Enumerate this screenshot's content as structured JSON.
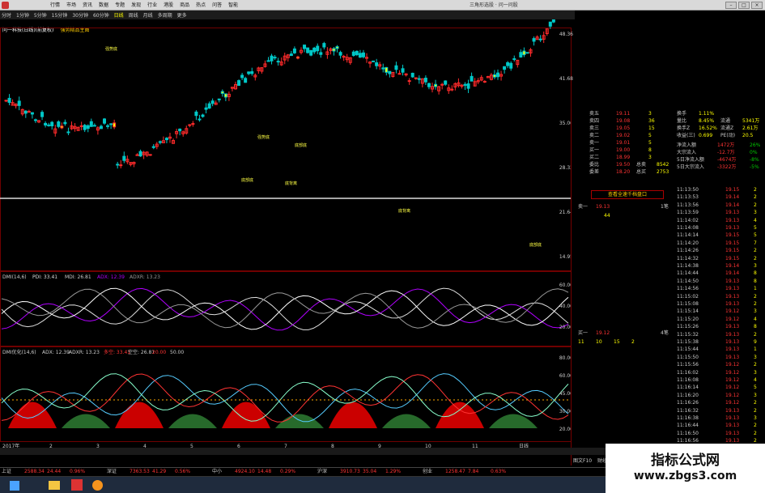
{
  "menubar": {
    "items": [
      "行情",
      "市场",
      "资讯",
      "数据",
      "专题",
      "发现",
      "行业",
      "港股",
      "商品",
      "热点",
      "问答",
      "智能"
    ],
    "title": "三角形选股 · 问一问股"
  },
  "toolbar": {
    "timeframes": [
      "分时",
      "1分钟",
      "5分钟",
      "15分钟",
      "30分钟",
      "60分钟",
      "日线",
      "周线",
      "月线",
      "多周期",
      "更多"
    ],
    "active": 6
  },
  "chart_header": {
    "left": "问一科技(日线)(前复权)",
    "right": "强势精品主图"
  },
  "main_chart": {
    "price_labels": [
      "48.36",
      "41.68",
      "35.00",
      "28.32",
      "21.64",
      "14.95"
    ],
    "tags": [
      "强势底",
      "强势底",
      "底部底",
      "底部底",
      "底背离",
      "底背离",
      "底部底"
    ]
  },
  "dmi": {
    "title": "DMI(14,6)",
    "pdi": "PDI: 33.41",
    "mdi": "MDI: 26.81",
    "adx": "ADX: 12.39",
    "adxr": "ADXR: 13.23",
    "axis": [
      "60.00",
      "40.00",
      "20.00"
    ]
  },
  "dmi2": {
    "title": "DMI优化(14,6)",
    "adx": "ADX: 12.39",
    "adxr": "ADXR: 13.23",
    "pdi": "多空: 33.41",
    "mdi": "空空: 26.81",
    "up": "20.00",
    "down": "50.00",
    "axis": [
      "80.00",
      "60.00",
      "45.00",
      "30.00",
      "20.00"
    ]
  },
  "time_axis": [
    "2017年",
    "2",
    "3",
    "4",
    "5",
    "6",
    "7",
    "8",
    "9",
    "10",
    "11",
    "日线"
  ],
  "side": {
    "sell_rows": [
      [
        "卖五",
        "19.11",
        "3"
      ],
      [
        "卖四",
        "19.08",
        "36"
      ],
      [
        "卖三",
        "19.05",
        "15"
      ],
      [
        "卖二",
        "19.02",
        "5"
      ],
      [
        "卖一",
        "19.01",
        "5"
      ]
    ],
    "buy_rows": [
      [
        "买一",
        "19.00",
        "8"
      ],
      [
        "买二",
        "18.99",
        "3"
      ]
    ],
    "totals": [
      [
        "委比",
        "19.50",
        "总卖",
        "8542"
      ],
      [
        "委差",
        "18.20",
        "总买",
        "2753"
      ]
    ],
    "info_rows": [
      [
        "换手",
        "1.11%"
      ],
      [
        "量比",
        "8.45%",
        "流通",
        "5341万"
      ],
      [
        "换手Z",
        "16.52%",
        "流通Z",
        "2.61万"
      ],
      [
        "收益(三)",
        "0.699",
        "PE(动)",
        "20.5"
      ]
    ],
    "flow_rows": [
      [
        "净流入额",
        "1472万",
        "26%"
      ],
      [
        "大宗流入",
        "-12.7万",
        "0%"
      ],
      [
        "5日净流入额",
        "-4674万",
        "-8%"
      ],
      [
        "5日大宗流入",
        "-3322万",
        "-5%"
      ]
    ],
    "button": "查看全速千档盘口",
    "sell_queue": [
      "卖一",
      "19.13",
      "1笔"
    ],
    "bid_queue": [
      "买一",
      "19.12",
      "4笔"
    ],
    "queue_vals": [
      "11",
      "10",
      "15",
      "2"
    ],
    "qty_label": "44",
    "ticks": [
      [
        "11:13:50",
        "19.15",
        "2"
      ],
      [
        "11:13:53",
        "19.14",
        "2"
      ],
      [
        "11:13:56",
        "19.14",
        "2"
      ],
      [
        "11:13:59",
        "19.13",
        "3"
      ],
      [
        "11:14:02",
        "19.13",
        "4"
      ],
      [
        "11:14:08",
        "19.13",
        "5"
      ],
      [
        "11:14:14",
        "19.15",
        "5"
      ],
      [
        "11:14:20",
        "19.15",
        "7"
      ],
      [
        "11:14:26",
        "19.15",
        "2"
      ],
      [
        "11:14:32",
        "19.15",
        "2"
      ],
      [
        "11:14:38",
        "19.14",
        "3"
      ],
      [
        "11:14:44",
        "19.14",
        "8"
      ],
      [
        "11:14:50",
        "19.13",
        "8"
      ],
      [
        "11:14:56",
        "19.13",
        "1"
      ],
      [
        "11:15:02",
        "19.13",
        "2"
      ],
      [
        "11:15:08",
        "19.13",
        "2"
      ],
      [
        "11:15:14",
        "19.12",
        "3"
      ],
      [
        "11:15:20",
        "19.12",
        "4"
      ],
      [
        "11:15:26",
        "19.13",
        "8"
      ],
      [
        "11:15:32",
        "19.13",
        "2"
      ],
      [
        "11:15:38",
        "19.13",
        "9"
      ],
      [
        "11:15:44",
        "19.13",
        "1"
      ],
      [
        "11:15:50",
        "19.13",
        "3"
      ],
      [
        "11:15:56",
        "19.12",
        "2"
      ],
      [
        "11:16:02",
        "19.12",
        "3"
      ],
      [
        "11:16:08",
        "19.12",
        "4"
      ],
      [
        "11:16:14",
        "19.12",
        "5"
      ],
      [
        "11:16:20",
        "19.12",
        "3"
      ],
      [
        "11:16:26",
        "19.12",
        "2"
      ],
      [
        "11:16:32",
        "19.13",
        "2"
      ],
      [
        "11:16:38",
        "19.13",
        "3"
      ],
      [
        "11:16:44",
        "19.13",
        "2"
      ],
      [
        "11:16:50",
        "19.13",
        "2"
      ],
      [
        "11:16:56",
        "19.13",
        "2"
      ],
      [
        "11:17:02",
        "19.15",
        "7"
      ],
      [
        "11:17:08",
        "19.15",
        "1"
      ]
    ],
    "footer": [
      "图文F10",
      "财经",
      "关联"
    ]
  },
  "bottom_tabs": [
    "分类",
    "A股",
    "创业",
    "中小",
    "B股",
    "基金",
    "债券",
    "港股",
    "美股",
    "期货",
    "外汇",
    "指数",
    "板块",
    "概念",
    "行业",
    "地区",
    "风格",
    "主力",
    "资金",
    "研报",
    "互动",
    "热门",
    "自选",
    "最近",
    "条件",
    "预警",
    "主题",
    "龙虎",
    "大宗",
    "融资",
    "限售",
    "新股",
    "解禁",
    "期权",
    "更多"
  ],
  "index_bar": [
    [
      "上证",
      "2588.34",
      "24.44",
      "0.96%"
    ],
    [
      "深证",
      "7363.53",
      "41.29",
      "0.56%"
    ],
    [
      "中小",
      "4924.10",
      "14.48",
      "0.29%"
    ],
    [
      "沪深",
      "3910.73",
      "35.04",
      "1.29%"
    ],
    [
      "创业",
      "1258.47",
      "7.84",
      "0.63%"
    ]
  ],
  "watermark": {
    "line1": "指标公式网",
    "line2": "www.zbgs3.com"
  },
  "colors": {
    "up": "#ff2b2b",
    "down": "#00c8c8",
    "yellow": "#ffff00",
    "grid": "#700000",
    "purple": "#b000ff",
    "green": "#2e7d32"
  }
}
